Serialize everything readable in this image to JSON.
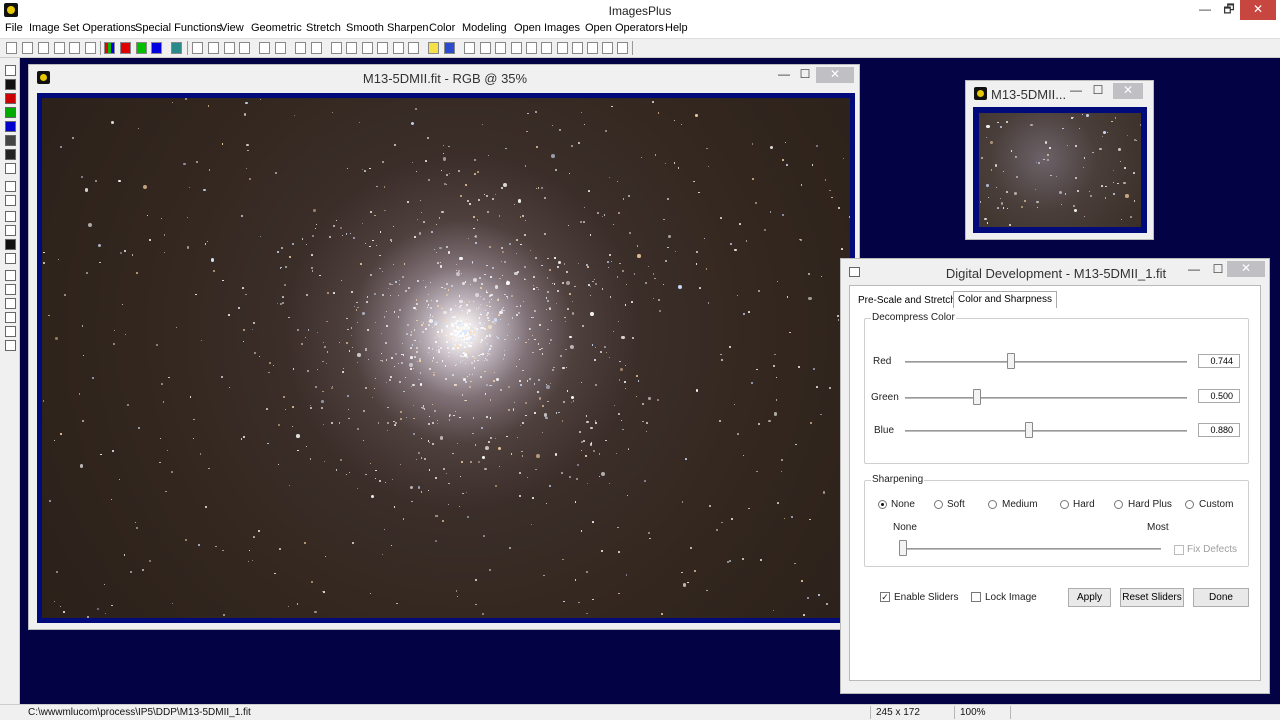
{
  "app": {
    "title": "ImagesPlus"
  },
  "window_controls": {
    "minimize": "—",
    "maximize": "🗗",
    "close": "✕"
  },
  "menu": [
    "File",
    "Image Set Operations",
    "Special Functions",
    "View",
    "Geometric",
    "Stretch",
    "Smooth Sharpen",
    "Color",
    "Modeling",
    "Open Images",
    "Open Operators",
    "Help"
  ],
  "image_window": {
    "title": "M13-5DMII.fit - RGB @ 35%"
  },
  "thumb_window": {
    "title": "M13-5DMII..."
  },
  "dialog": {
    "title": "Digital Development - M13-5DMII_1.fit",
    "tabs": [
      "Pre-Scale and Stretch",
      "Color and Sharpness"
    ],
    "active_tab": "Color and Sharpness",
    "decompress_group": "Decompress Color",
    "sliders": [
      {
        "label": "Red",
        "value": "0.744",
        "level": 0.38
      },
      {
        "label": "Green",
        "value": "0.500",
        "level": 0.26
      },
      {
        "label": "Blue",
        "value": "0.880",
        "level": 0.44
      }
    ],
    "sharpening_group": "Sharpening",
    "sharpening_options": [
      "None",
      "Soft",
      "Medium",
      "Hard",
      "Hard Plus",
      "Custom"
    ],
    "sharpening_selected": "None",
    "sharpen_min_label": "None",
    "sharpen_max_label": "Most",
    "fix_defects": "Fix Defects",
    "enable_sliders": "Enable Sliders",
    "enable_sliders_checked": true,
    "lock_image": "Lock Image",
    "lock_image_checked": false,
    "apply": "Apply",
    "reset_sliders": "Reset Sliders",
    "done": "Done"
  },
  "status": {
    "path": "C:\\wwwmlucom\\process\\IP5\\DDP\\M13-5DMII_1.fit",
    "coords": "245 x 172",
    "zoom": "100%"
  },
  "colors": {
    "workspace": "#020245",
    "image_frame": "#000a7a",
    "close_red": "#c7463f"
  }
}
